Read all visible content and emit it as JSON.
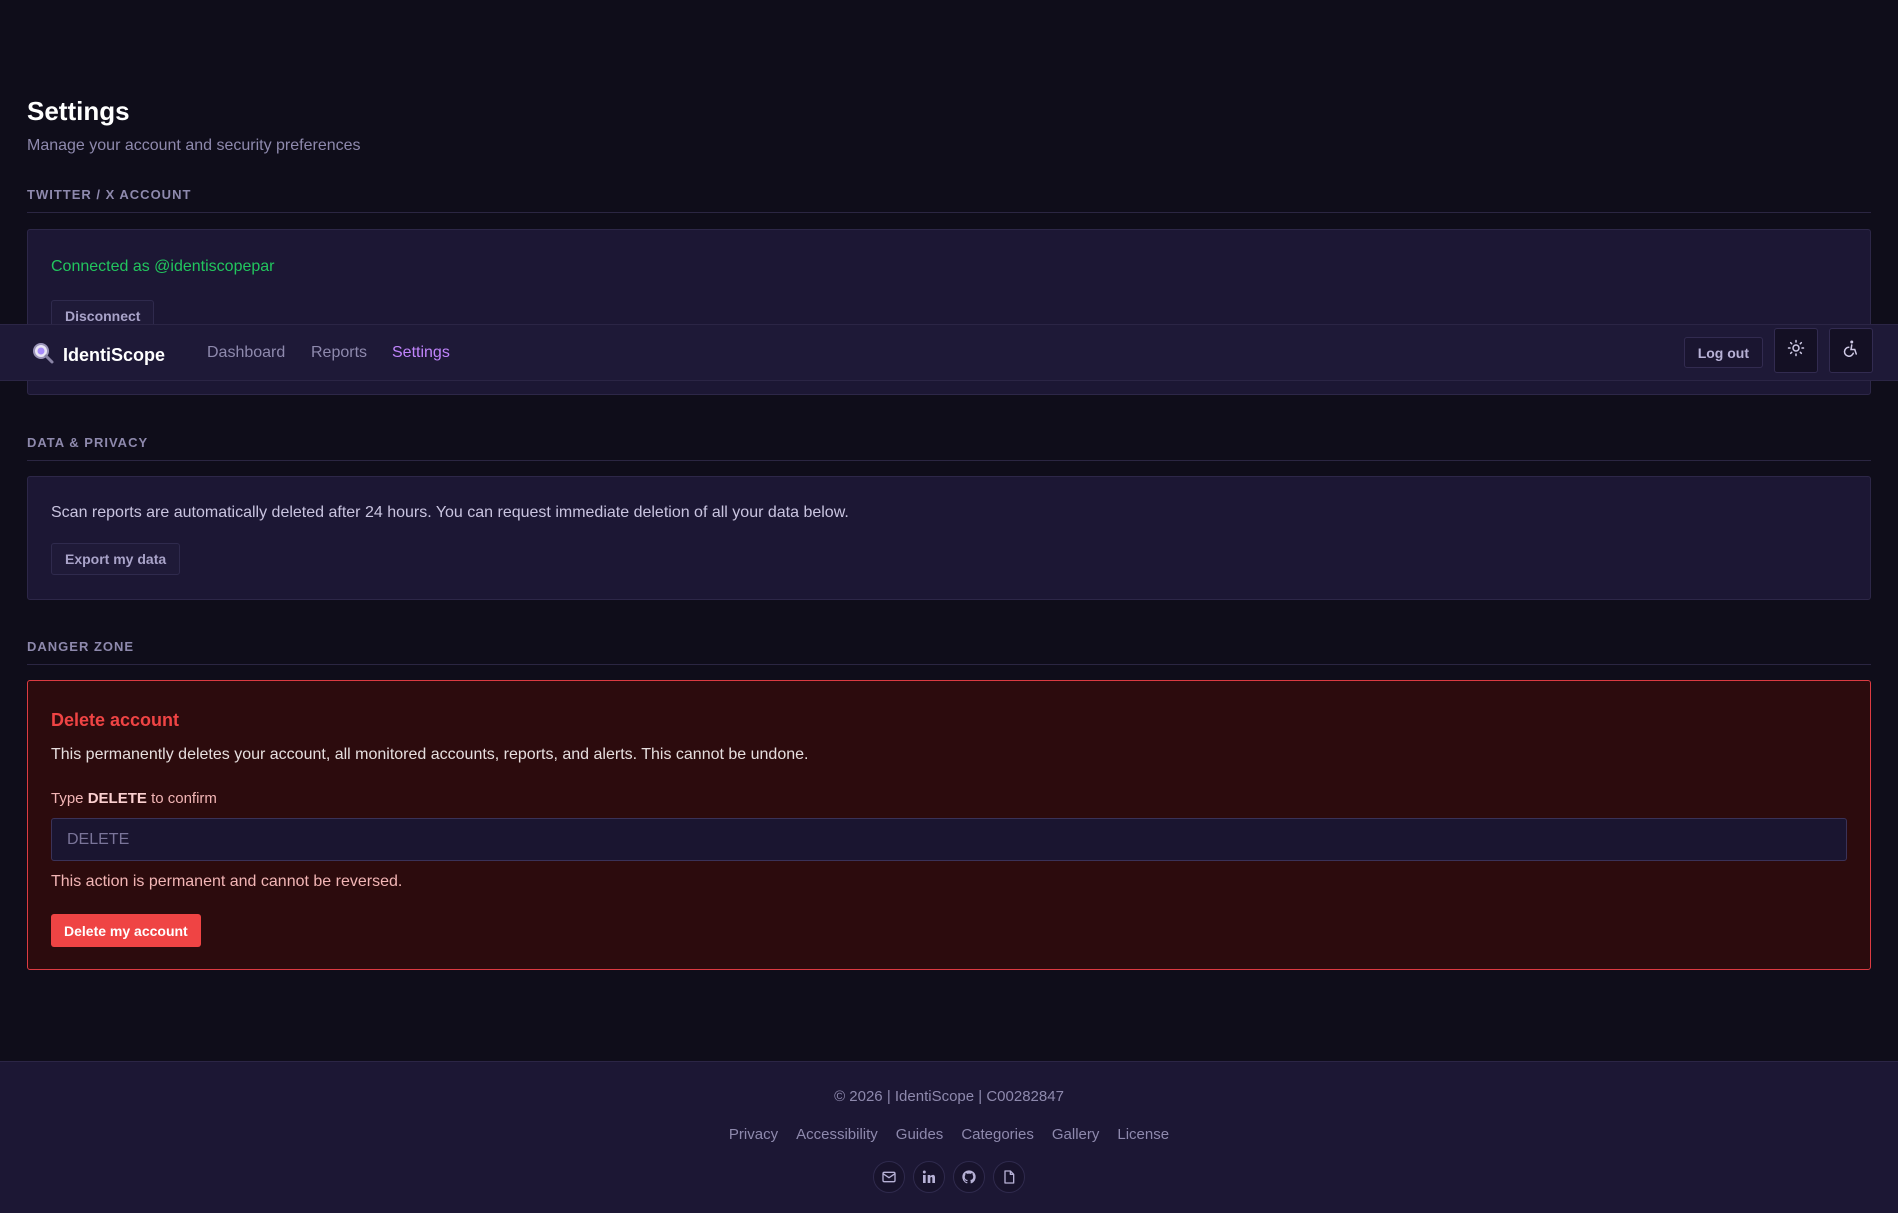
{
  "page": {
    "title": "Settings",
    "subtitle": "Manage your account and security preferences"
  },
  "twitter": {
    "heading": "TWITTER / X ACCOUNT",
    "connected_text": "Connected as @identiscopepar",
    "disconnect_label": "Disconnect"
  },
  "privacy": {
    "heading": "DATA & PRIVACY",
    "text": "Scan reports are automatically deleted after 24 hours. You can request immediate deletion of all your data below.",
    "export_label": "Export my data"
  },
  "danger": {
    "heading": "DANGER ZONE",
    "title": "Delete account",
    "text": "This permanently deletes your account, all monitored accounts, reports, and alerts. This cannot be undone.",
    "confirm_prefix": "Type",
    "confirm_keyword": "DELETE",
    "confirm_suffix": "to confirm",
    "input_placeholder": "DELETE",
    "warning": "This action is permanent and cannot be reversed.",
    "delete_label": "Delete my account"
  },
  "navbar": {
    "brand": "IdentiScope",
    "links": [
      "Dashboard",
      "Reports",
      "Settings"
    ],
    "active_link": "Settings",
    "logout_label": "Log out",
    "theme_icon": "sun-icon",
    "accessibility_icon": "accessibility-icon"
  },
  "footer": {
    "copyright": "© 2026 | IdentiScope | C00282847",
    "links": [
      "Privacy",
      "Accessibility",
      "Guides",
      "Categories",
      "Gallery",
      "License"
    ],
    "icons": [
      "mail-icon",
      "linkedin-icon",
      "github-icon",
      "document-icon"
    ]
  },
  "colors": {
    "background": "#0f0d1a",
    "card": "#1c1734",
    "accent": "#c084fc",
    "success": "#22c55e",
    "danger": "#ef4444",
    "danger_bg": "#2c0b0d"
  }
}
